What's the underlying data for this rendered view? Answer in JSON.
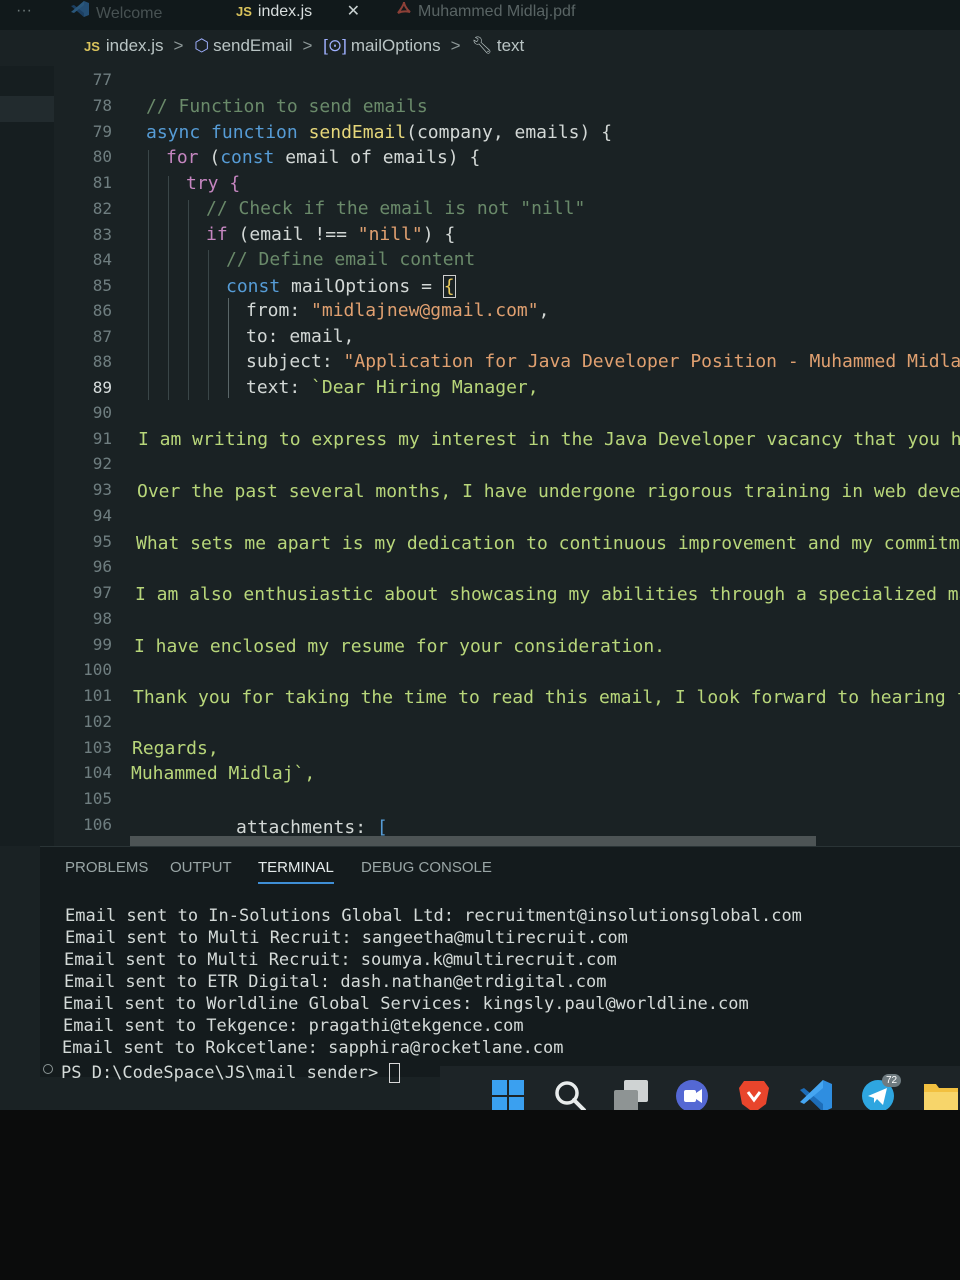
{
  "tabs": [
    {
      "label": "Welcome",
      "icon": "vscode-logo-icon"
    },
    {
      "label": "index.js",
      "icon": "JS"
    },
    {
      "label": "Muhammed Midlaj.pdf",
      "icon": "pdf-icon"
    }
  ],
  "more_label": "···",
  "close_glyph": "✕",
  "breadcrumb": {
    "file_icon": "JS",
    "file": "index.js",
    "fn": "sendEmail",
    "var": "mailOptions",
    "prop": "text"
  },
  "line_numbers": [
    "77",
    "78",
    "79",
    "80",
    "81",
    "82",
    "83",
    "84",
    "85",
    "86",
    "87",
    "88",
    "89",
    "90",
    "91",
    "92",
    "93",
    "94",
    "95",
    "96",
    "97",
    "98",
    "99",
    "100",
    "101",
    "102",
    "103",
    "104",
    "105",
    "106"
  ],
  "code": {
    "l78": "// Function to send emails",
    "l79_a": "async",
    "l79_b": "function",
    "l79_c": "sendEmail",
    "l79_d": "(company, emails) {",
    "l80_a": "for",
    "l80_b": "(",
    "l80_c": "const",
    "l80_d": "email of emails) {",
    "l81": "try {",
    "l82": "// Check if the email is not \"nill\"",
    "l83_a": "if",
    "l83_b": "(email !== ",
    "l83_c": "\"nill\"",
    "l83_d": ") {",
    "l84": "// Define email content",
    "l85_a": "const",
    "l85_b": "mailOptions = ",
    "l85_c": "{",
    "l86_a": "from: ",
    "l86_b": "\"midlajnew@gmail.com\"",
    "l86_c": ",",
    "l87": "to: email,",
    "l88_a": "subject: ",
    "l88_b": "\"Application for Java Developer Position - Muhammed Midlaj\"",
    "l89_a": "text: ",
    "l89_b": "`Dear Hiring Manager,",
    "l91": "I am writing to express my interest in the Java Developer vacancy that you hav",
    "l93": "Over the past several months, I have undergone rigorous training in web develo",
    "l95": "What sets me apart is my dedication to continuous improvement and my commitmen",
    "l97": "I am also enthusiastic about showcasing my abilities through a specialized mac",
    "l99": "I have enclosed my resume for your consideration.",
    "l101": "Thank you for taking the time to read this email, I look forward to hearing fr",
    "l103": "Regards,",
    "l104": "Muhammed Midlaj`,",
    "l106_a": "attachments: ",
    "l106_b": "["
  },
  "panel_tabs": [
    "PROBLEMS",
    "OUTPUT",
    "TERMINAL",
    "DEBUG CONSOLE"
  ],
  "terminal_lines": [
    "Email sent to In-Solutions Global Ltd: recruitment@insolutionsglobal.com",
    "Email sent to Multi Recruit: sangeetha@multirecruit.com",
    "Email sent to Multi Recruit: soumya.k@multirecruit.com",
    "Email sent to ETR Digital: dash.nathan@etrdigital.com",
    "Email sent to Worldline Global Services: kingsly.paul@worldline.com",
    "Email sent to Tekgence: pragathi@tekgence.com",
    "Email sent to Rokcetlane: sapphira@rocketlane.com"
  ],
  "prompt": "PS D:\\CodeSpace\\JS\\mail sender> ",
  "taskbar": {
    "icons": [
      "windows-start-icon",
      "search-icon",
      "task-view-icon",
      "meet-chat-icon",
      "brave-browser-icon",
      "vscode-icon",
      "telegram-icon",
      "file-explorer-icon"
    ],
    "telegram_badge": "72"
  }
}
